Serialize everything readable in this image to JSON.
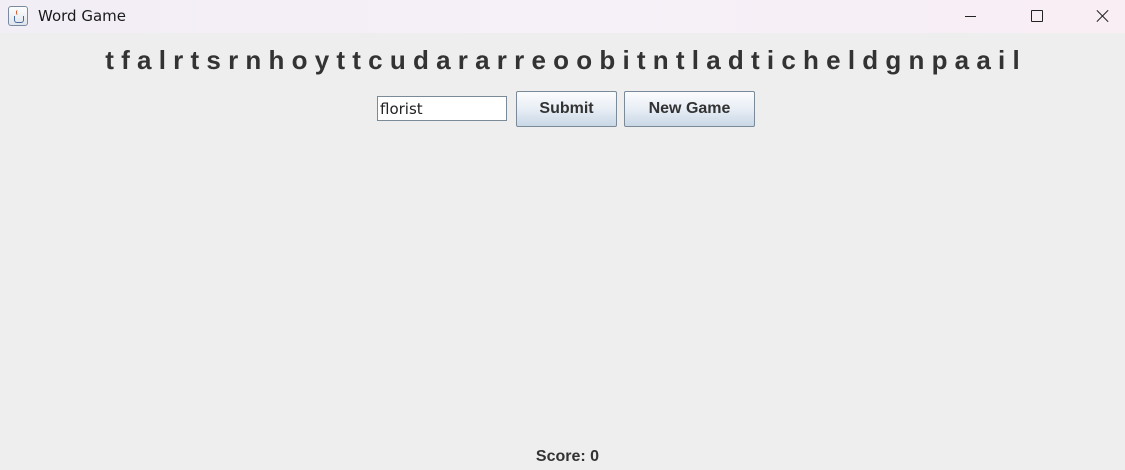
{
  "window": {
    "title": "Word Game",
    "icon": "java-cup-icon"
  },
  "game": {
    "letters": "t f a l r t s r n h o y t t c u d a r a r r e o o b i t n t l a d t i c h e l d g n p a a i l",
    "input_value": "florist",
    "submit_label": "Submit",
    "new_game_label": "New Game",
    "score_text": "Score: 0"
  }
}
